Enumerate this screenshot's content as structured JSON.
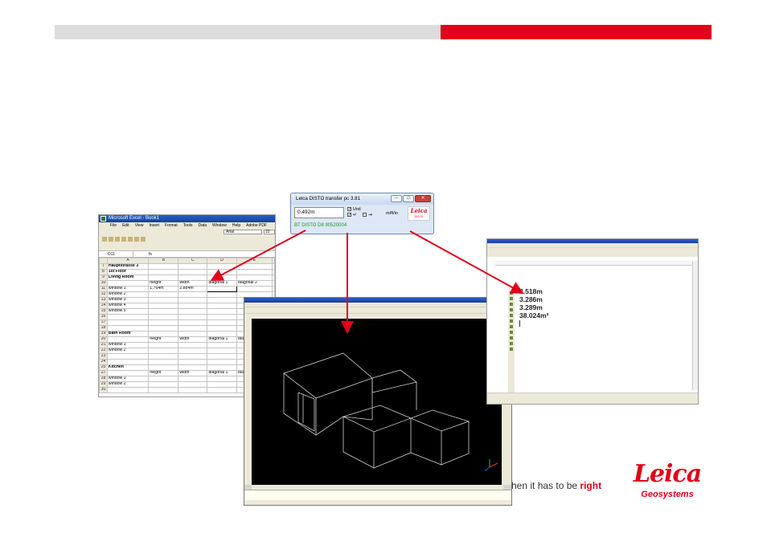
{
  "excel": {
    "title": "Microsoft Excel - Book1",
    "menu": [
      "File",
      "Edit",
      "View",
      "Insert",
      "Format",
      "Tools",
      "Data",
      "Window",
      "Help",
      "Adobe PDF"
    ],
    "font": "Arial",
    "font_size": "10",
    "name_box": "D11",
    "columns": [
      "A",
      "B",
      "C",
      "D",
      "E"
    ],
    "rows": [
      {
        "n": "7",
        "cells": [
          "Hauptstrasse 3",
          "",
          "",
          "",
          ""
        ],
        "bold": true
      },
      {
        "n": "8",
        "cells": [
          "1st Floor",
          "",
          "",
          "",
          ""
        ],
        "bold": true
      },
      {
        "n": "9",
        "cells": [
          "Living Room",
          "",
          "",
          "",
          ""
        ],
        "bold": true
      },
      {
        "n": "10",
        "cells": [
          "",
          "height",
          "width",
          "diagonal 1",
          "diagonal 2"
        ]
      },
      {
        "n": "11",
        "cells": [
          "window 1",
          "1.764m",
          "2.884m",
          "",
          ""
        ]
      },
      {
        "n": "12",
        "cells": [
          "window 2",
          "",
          "",
          "",
          ""
        ]
      },
      {
        "n": "13",
        "cells": [
          "window 3",
          "",
          "",
          "",
          ""
        ]
      },
      {
        "n": "14",
        "cells": [
          "window 4",
          "",
          "",
          "",
          ""
        ]
      },
      {
        "n": "15",
        "cells": [
          "window 5",
          "",
          "",
          "",
          ""
        ]
      },
      {
        "n": "16",
        "cells": [
          "",
          "",
          "",
          "",
          ""
        ]
      },
      {
        "n": "17",
        "cells": [
          "",
          "",
          "",
          "",
          ""
        ]
      },
      {
        "n": "18",
        "cells": [
          "",
          "",
          "",
          "",
          ""
        ]
      },
      {
        "n": "19",
        "cells": [
          "Bath Room",
          "",
          "",
          "",
          ""
        ],
        "bold": true
      },
      {
        "n": "20",
        "cells": [
          "",
          "height",
          "width",
          "diagonal 1",
          "diagonal 2"
        ]
      },
      {
        "n": "21",
        "cells": [
          "window 1",
          "",
          "",
          "",
          ""
        ]
      },
      {
        "n": "22",
        "cells": [
          "window 2",
          "",
          "",
          "",
          ""
        ]
      },
      {
        "n": "23",
        "cells": [
          "",
          "",
          "",
          "",
          ""
        ]
      },
      {
        "n": "24",
        "cells": [
          "",
          "",
          "",
          "",
          ""
        ]
      },
      {
        "n": "25",
        "cells": [
          "Kitchen",
          "",
          "",
          "",
          ""
        ],
        "bold": true
      },
      {
        "n": "27",
        "cells": [
          "",
          "height",
          "width",
          "diagonal 1",
          "diagonal 2"
        ]
      },
      {
        "n": "28",
        "cells": [
          "window 1",
          "",
          "",
          "",
          ""
        ]
      },
      {
        "n": "29",
        "cells": [
          "window 2",
          "",
          "",
          "",
          ""
        ]
      },
      {
        "n": "30",
        "cells": [
          "",
          "",
          "",
          "",
          ""
        ]
      }
    ]
  },
  "disto": {
    "title": "Leica DISTO transfer pc 3.81",
    "value": "0.492m",
    "unit_label": "Unit",
    "units": "m/ft/in",
    "status": "BT DISTO D8 90520004",
    "logo": "Leica",
    "logo_sub": "DISTO"
  },
  "word": {
    "lines": [
      "3.518m",
      "3.286m",
      "3.289m",
      "38.024m³"
    ]
  },
  "footer": {
    "tagline_prefix": "hen it has to be ",
    "tagline_accent": "right",
    "logo_word": "Leica",
    "logo_sub": "Geosystems"
  },
  "colors": {
    "brand_red": "#e2001a",
    "header_grey": "#dcdcdc"
  }
}
